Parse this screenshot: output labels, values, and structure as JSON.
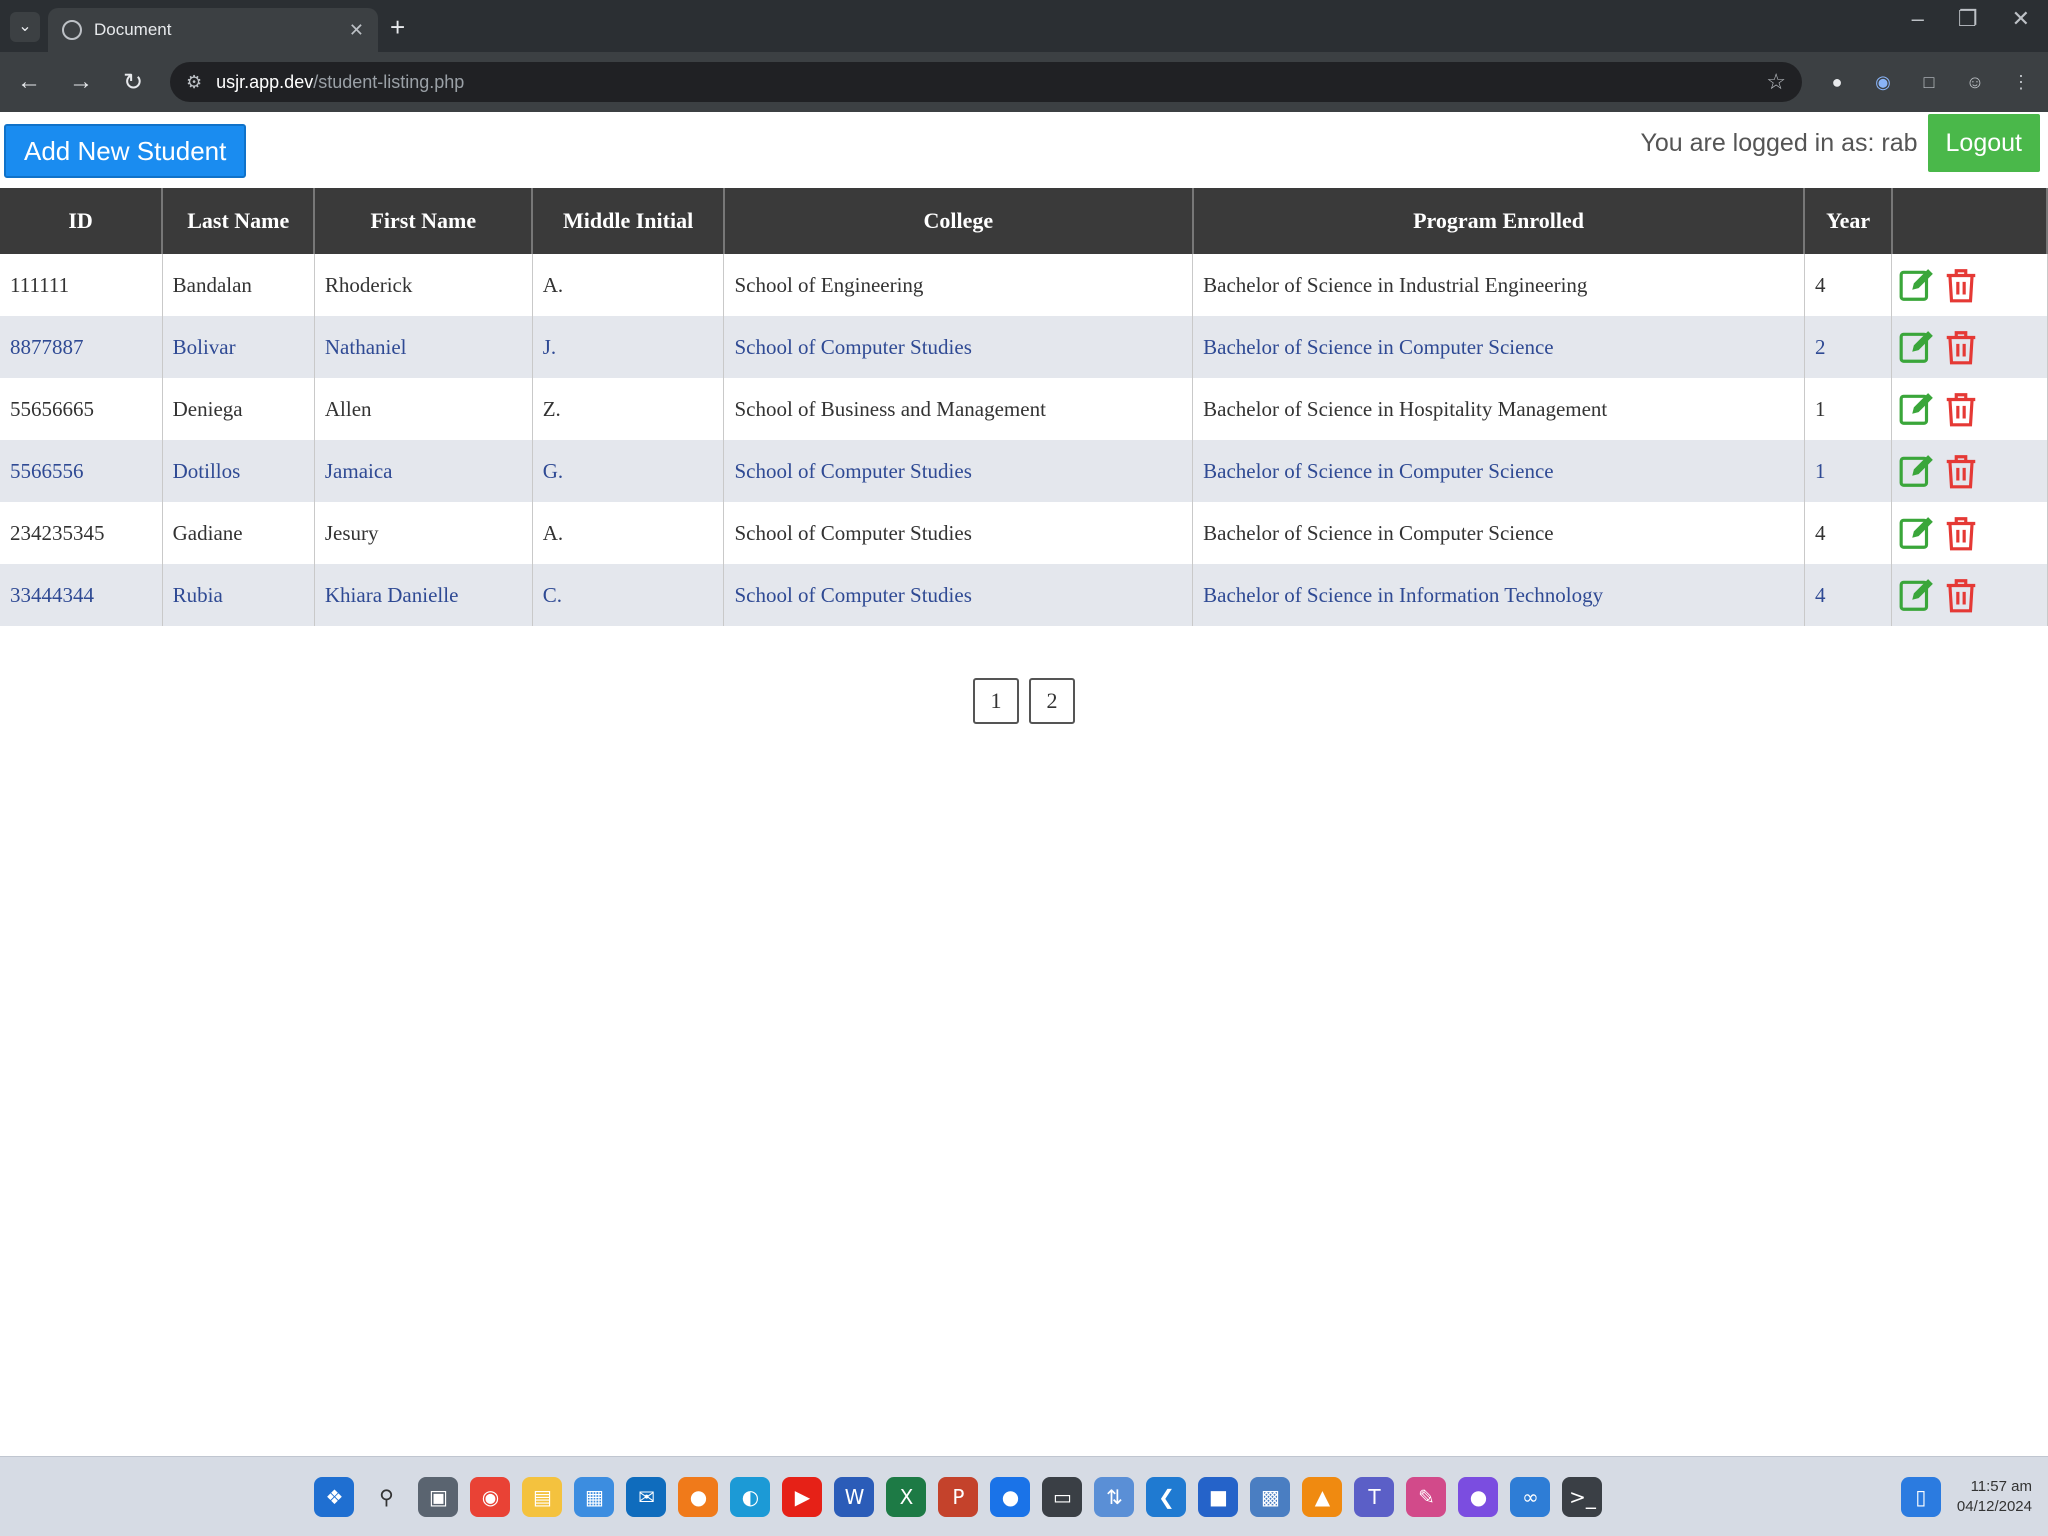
{
  "browser": {
    "tab_title": "Document",
    "url_host": "usjr.app.dev",
    "url_path": "/student-listing.php"
  },
  "page": {
    "add_button_label": "Add New Student",
    "logged_in_label": "You are logged in as: rab",
    "logout_label": "Logout"
  },
  "table": {
    "headers": {
      "id": "ID",
      "last_name": "Last Name",
      "first_name": "First Name",
      "middle_initial": "Middle Initial",
      "college": "College",
      "program": "Program Enrolled",
      "year": "Year"
    },
    "rows": [
      {
        "id": "111111",
        "last_name": "Bandalan",
        "first_name": "Rhoderick",
        "middle_initial": "A.",
        "college": "School of Engineering",
        "program": "Bachelor of Science in Industrial Engineering",
        "year": "4"
      },
      {
        "id": "8877887",
        "last_name": "Bolivar",
        "first_name": "Nathaniel",
        "middle_initial": "J.",
        "college": "School of Computer Studies",
        "program": "Bachelor of Science in Computer Science",
        "year": "2"
      },
      {
        "id": "55656665",
        "last_name": "Deniega",
        "first_name": "Allen",
        "middle_initial": "Z.",
        "college": "School of Business and Management",
        "program": "Bachelor of Science in Hospitality Management",
        "year": "1"
      },
      {
        "id": "5566556",
        "last_name": "Dotillos",
        "first_name": "Jamaica",
        "middle_initial": "G.",
        "college": "School of Computer Studies",
        "program": "Bachelor of Science in Computer Science",
        "year": "1"
      },
      {
        "id": "234235345",
        "last_name": "Gadiane",
        "first_name": "Jesury",
        "middle_initial": "A.",
        "college": "School of Computer Studies",
        "program": "Bachelor of Science in Computer Science",
        "year": "4"
      },
      {
        "id": "33444344",
        "last_name": "Rubia",
        "first_name": "Khiara Danielle",
        "middle_initial": "C.",
        "college": "School of Computer Studies",
        "program": "Bachelor of Science in Information Technology",
        "year": "4"
      }
    ]
  },
  "pagination": [
    "1",
    "2"
  ],
  "taskbar": {
    "time": "11:57 am",
    "date": "04/12/2024"
  },
  "colors": {
    "add_button": "#1a8cf0",
    "logout_button": "#4ab84a",
    "header_bg": "#3a3a3a",
    "edit_icon": "#3aa63a",
    "delete_icon": "#e53935"
  }
}
